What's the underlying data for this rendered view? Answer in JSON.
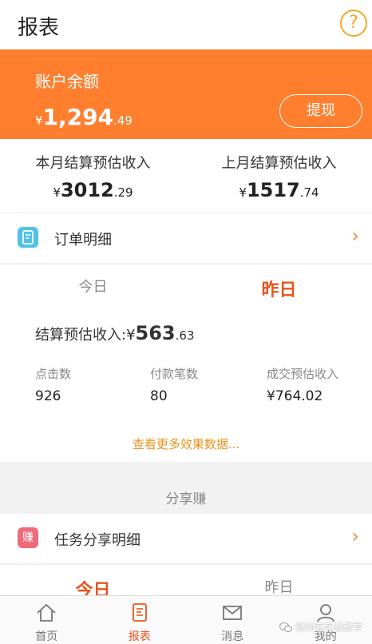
{
  "header": {
    "title": "报表",
    "help_glyph": "?"
  },
  "balance": {
    "label": "账户余额",
    "currency": "¥",
    "integer": "1,294",
    "decimal": ".49",
    "withdraw_label": "提现"
  },
  "monthly": {
    "this_month": {
      "label": "本月结算预估收入",
      "currency": "¥",
      "integer": "3012",
      "decimal": ".29"
    },
    "last_month": {
      "label": "上月结算预估收入",
      "currency": "¥",
      "integer": "1517",
      "decimal": ".74"
    }
  },
  "order_detail": {
    "label": "订单明细"
  },
  "day_tabs": {
    "today": "今日",
    "yesterday": "昨日",
    "active": "yesterday"
  },
  "estimate": {
    "label": "结算预估收入:",
    "currency": "¥",
    "integer": "563",
    "decimal": ".63"
  },
  "stats": [
    {
      "label": "点击数",
      "value": "926"
    },
    {
      "label": "付款笔数",
      "value": "80"
    },
    {
      "label": "成交预估收入",
      "value": "¥764.02"
    }
  ],
  "more_link": "查看更多效果数据...",
  "share_section": {
    "title": "分享赚"
  },
  "task_share": {
    "icon_text": "赚",
    "label": "任务分享明细"
  },
  "share_tabs": {
    "today": "今日",
    "yesterday": "昨日",
    "active": "today"
  },
  "bottom_nav": [
    {
      "label": "首页",
      "icon": "home-icon"
    },
    {
      "label": "报表",
      "icon": "report-icon",
      "active": true
    },
    {
      "label": "消息",
      "icon": "mail-icon"
    },
    {
      "label": "我的",
      "icon": "user-icon"
    }
  ],
  "watermark": "微淘客实战教学",
  "colors": {
    "accent": "#ff7f2f",
    "active_text": "#e8541c",
    "link": "#e8941c",
    "help": "#f5a623"
  }
}
